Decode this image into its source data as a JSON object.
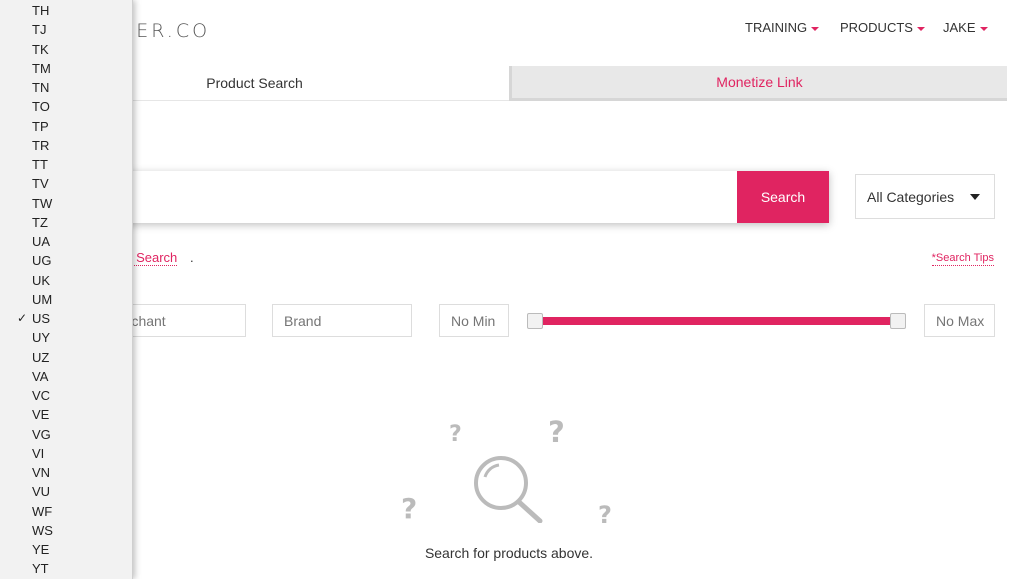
{
  "header": {
    "logo_text": "CER.CO",
    "nav": [
      {
        "label": "TRAINING"
      },
      {
        "label": "PRODUCTS"
      },
      {
        "label": "JAKE"
      }
    ]
  },
  "tabs": [
    {
      "label": "Product Search",
      "active": true
    },
    {
      "label": "Monetize Link",
      "active": false
    }
  ],
  "search": {
    "input_value": "",
    "button_label": "Search",
    "category_selected": "All Categories",
    "advanced_link": "ed Search",
    "advanced_suffix": ".",
    "tips_link": "*Search Tips"
  },
  "filters": {
    "merchant_placeholder": "erchant",
    "brand_placeholder": "Brand",
    "min_placeholder": "No Min",
    "max_placeholder": "No Max"
  },
  "empty_state": {
    "marks": [
      "?",
      "?",
      "?",
      "?"
    ],
    "message": "Search for products above."
  },
  "country_dropdown": {
    "selected": "US",
    "options": [
      "TH",
      "TJ",
      "TK",
      "TM",
      "TN",
      "TO",
      "TP",
      "TR",
      "TT",
      "TV",
      "TW",
      "TZ",
      "UA",
      "UG",
      "UK",
      "UM",
      "US",
      "UY",
      "UZ",
      "VA",
      "VC",
      "VE",
      "VG",
      "VI",
      "VN",
      "VU",
      "WF",
      "WS",
      "YE",
      "YT"
    ]
  },
  "colors": {
    "accent": "#e02461",
    "tab_inactive_bg": "#e8e8e8",
    "dropdown_bg": "#f2f2f2"
  }
}
